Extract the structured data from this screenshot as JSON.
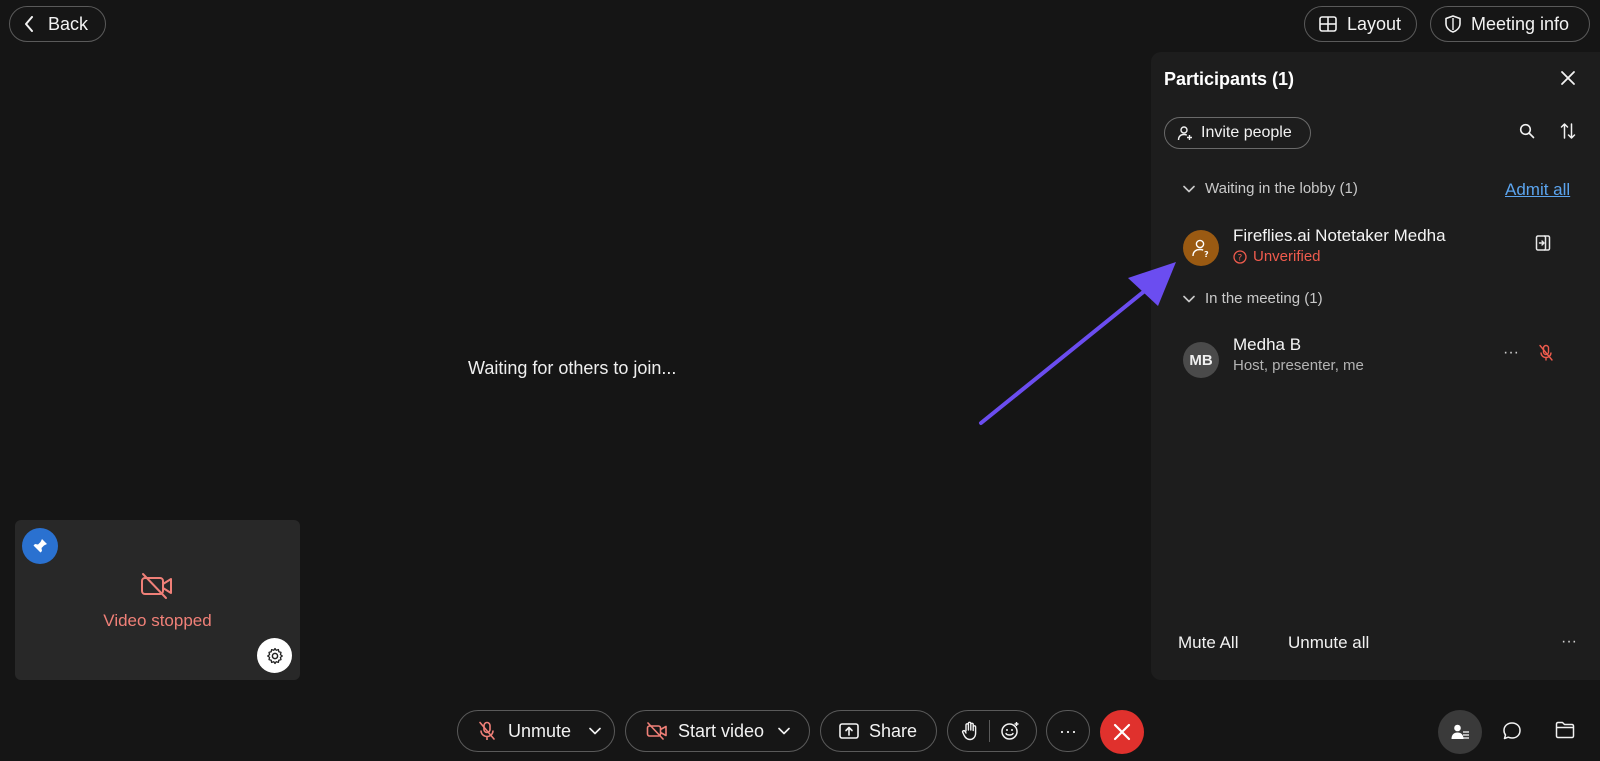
{
  "topbar": {
    "back_label": "Back",
    "layout_label": "Layout",
    "meeting_info_label": "Meeting info"
  },
  "stage": {
    "waiting_text": "Waiting for others to join..."
  },
  "self_view": {
    "status_text": "Video stopped"
  },
  "participants_panel": {
    "title": "Participants (1)",
    "invite_label": "Invite people",
    "lobby": {
      "heading": "Waiting in the lobby (1)",
      "admit_all_label": "Admit all",
      "entries": [
        {
          "name": "Fireflies.ai Notetaker Medha",
          "status": "Unverified"
        }
      ]
    },
    "meeting": {
      "heading": "In the meeting (1)",
      "entries": [
        {
          "initials": "MB",
          "name": "Medha B",
          "roles": "Host, presenter, me"
        }
      ]
    },
    "mute_all_label": "Mute All",
    "unmute_all_label": "Unmute all",
    "more_label": "···"
  },
  "toolbar": {
    "unmute_label": "Unmute",
    "start_video_label": "Start video",
    "share_label": "Share",
    "more_label": "···"
  },
  "colors": {
    "background": "#151515",
    "panel": "#1d1d1d",
    "accent_link": "#5ba4ee",
    "error": "#ef5b4d",
    "end_call": "#e0312d",
    "annotation_arrow": "#6b4df0"
  },
  "annotation": {
    "type": "arrow",
    "points_to": "lobby participant entry"
  }
}
